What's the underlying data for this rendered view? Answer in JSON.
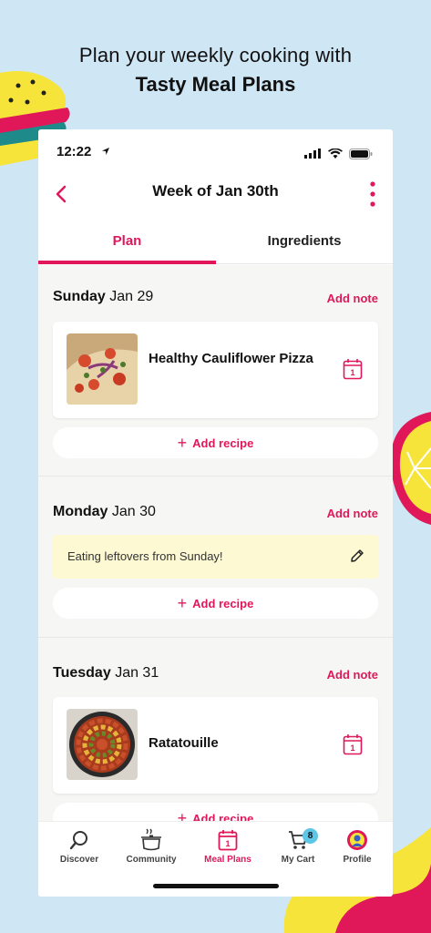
{
  "promo": {
    "line1": "Plan your weekly cooking with",
    "line2": "Tasty Meal Plans"
  },
  "status_bar": {
    "time": "12:22"
  },
  "header": {
    "title": "Week of Jan 30th"
  },
  "tabs": [
    {
      "label": "Plan",
      "active": true
    },
    {
      "label": "Ingredients",
      "active": false
    }
  ],
  "days": [
    {
      "day": "Sunday",
      "date": "Jan 29",
      "add_note": "Add note",
      "recipe": {
        "title": "Healthy Cauliflower Pizza"
      },
      "add_recipe": "Add recipe"
    },
    {
      "day": "Monday",
      "date": "Jan 30",
      "add_note": "Add note",
      "note": "Eating leftovers from Sunday!",
      "add_recipe": "Add recipe"
    },
    {
      "day": "Tuesday",
      "date": "Jan 31",
      "add_note": "Add note",
      "recipe": {
        "title": "Ratatouille"
      },
      "add_recipe": "Add recipe"
    }
  ],
  "calendar_icon_day": "1",
  "bottom_nav": [
    {
      "label": "Discover",
      "icon": "search-icon"
    },
    {
      "label": "Community",
      "icon": "pot-icon"
    },
    {
      "label": "Meal Plans",
      "icon": "calendar-icon",
      "active": true
    },
    {
      "label": "My Cart",
      "icon": "cart-icon",
      "badge": "8"
    },
    {
      "label": "Profile",
      "icon": "avatar"
    }
  ],
  "colors": {
    "accent": "#e0185a",
    "background": "#cfe6f5",
    "note_bg": "#fdf9d2",
    "badge": "#5ec6e6"
  }
}
